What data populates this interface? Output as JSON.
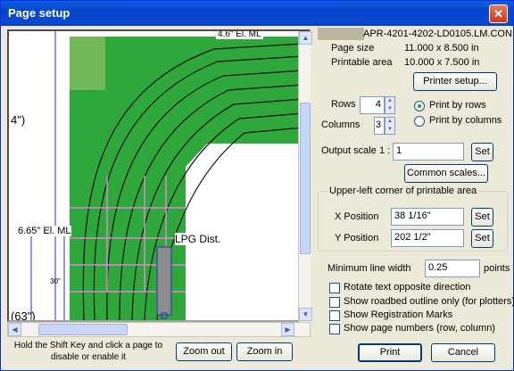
{
  "window": {
    "title": "Page setup",
    "close": "✕"
  },
  "preview": {
    "labels": {
      "top_label": "4.6\" El. ML",
      "left_label_4": "4\")",
      "elev_label": "6.65\" El. ML",
      "grade_label": "30\"",
      "left_label_63": "(63\")",
      "lpg_label": "LPG Dist."
    }
  },
  "hint": {
    "text": "Hold the Shift Key and click a page to disable or enable it"
  },
  "buttons": {
    "zoom_out": "Zoom out",
    "zoom_in": "Zoom in",
    "printer_setup": "Printer setup...",
    "set_scale": "Set",
    "common_scales": "Common scales...",
    "set_x": "Set",
    "set_y": "Set",
    "print": "Print",
    "cancel": "Cancel"
  },
  "info": {
    "filename": "APR-4201-4202-LD0105.LM.CON",
    "page_size_label": "Page size",
    "page_size_value": "11.000 x 8.500 in",
    "printable_area_label": "Printable area",
    "printable_area_value": "10.000 x 7.500 in"
  },
  "layout": {
    "rows_label": "Rows",
    "rows_value": "4",
    "columns_label": "Columns",
    "columns_value": "3",
    "print_by_rows": "Print by rows",
    "print_by_columns": "Print by columns",
    "print_order_selected": "rows"
  },
  "scale": {
    "label": "Output scale",
    "prefix": "1 :",
    "value": "1"
  },
  "corner": {
    "title": "Upper-left corner of printable area",
    "x_label": "X Position",
    "x_value": "38 1/16\"",
    "y_label": "Y Position",
    "y_value": "202 1/2\""
  },
  "line_width": {
    "label": "Minimum line width",
    "value": "0.25",
    "unit": "points"
  },
  "options": [
    {
      "label": "Rotate text opposite direction",
      "checked": false
    },
    {
      "label": "Show roadbed outline only (for plotters)",
      "checked": false
    },
    {
      "label": "Show Registration Marks",
      "checked": false
    },
    {
      "label": "Show page numbers (row, column)",
      "checked": false
    }
  ],
  "colors": {
    "titlebar": "#0a49d0",
    "layout_green": "#2ea83a",
    "page_grid": "#d98bd0"
  }
}
